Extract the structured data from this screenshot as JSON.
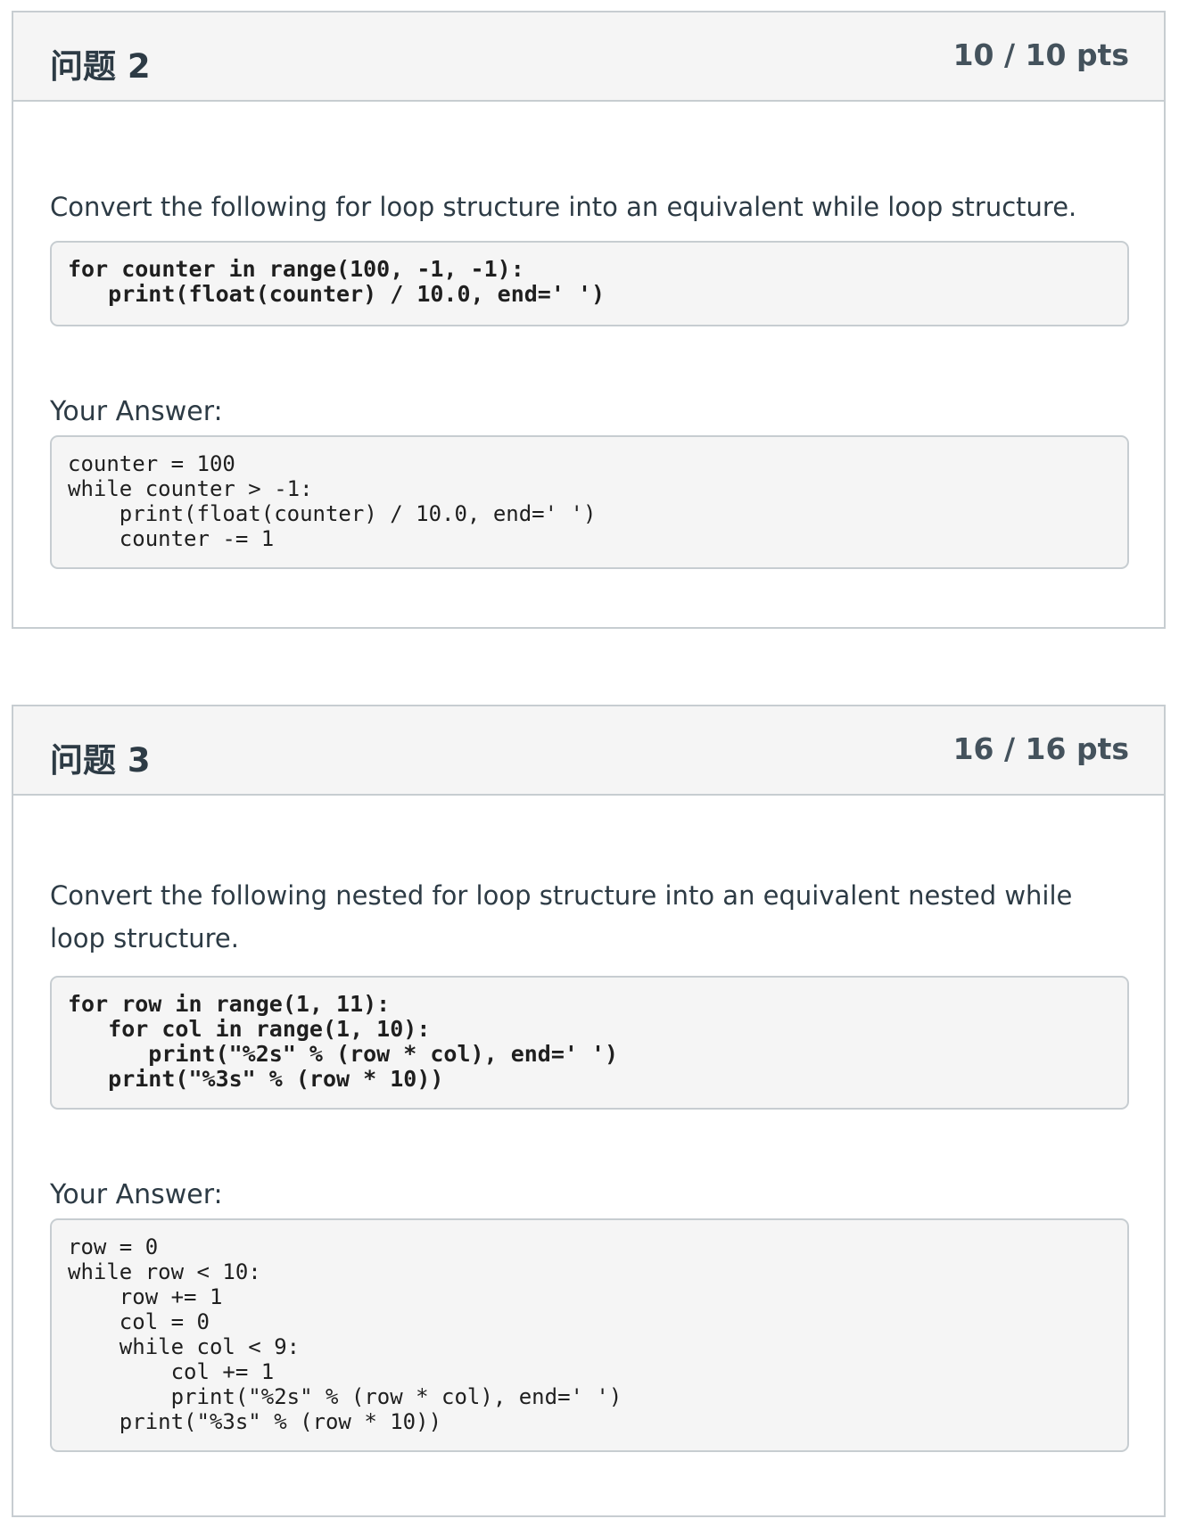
{
  "questions": [
    {
      "title": "问题 2",
      "points": "10 / 10 pts",
      "prompt": "Convert the following for loop structure into an equivalent while loop structure.",
      "prompt_code": "for counter in range(100, -1, -1):\n   print(float(counter) / 10.0, end=' ')",
      "answer_label": "Your Answer:",
      "answer_code": "counter = 100\nwhile counter > -1:\n    print(float(counter) / 10.0, end=' ')\n    counter -= 1"
    },
    {
      "title": "问题 3",
      "points": "16 / 16 pts",
      "prompt": "Convert the following nested for loop structure into an equivalent nested while loop structure.",
      "prompt_code": "for row in range(1, 11):\n   for col in range(1, 10):\n      print(\"%2s\" % (row * col), end=' ')\n   print(\"%3s\" % (row * 10))",
      "answer_label": "Your Answer:",
      "answer_code": "row = 0\nwhile row < 10:\n    row += 1\n    col = 0\n    while col < 9:\n        col += 1\n        print(\"%2s\" % (row * col), end=' ')\n    print(\"%3s\" % (row * 10))"
    }
  ]
}
